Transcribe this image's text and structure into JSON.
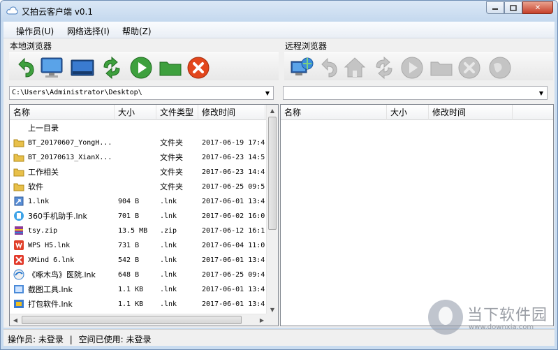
{
  "window": {
    "title": "又拍云客户端 v0.1",
    "controls": {
      "minimize": "▭",
      "maximize": "▢",
      "close": "✕"
    }
  },
  "menu": [
    "操作员(U)",
    "网络选择(I)",
    "帮助(Z)"
  ],
  "local": {
    "label": "本地浏览器",
    "path": "C:\\Users\\Administrator\\Desktop\\",
    "columns": [
      "名称",
      "大小",
      "文件类型",
      "修改时间"
    ],
    "files": [
      {
        "name": "上一目录",
        "size": "",
        "type": "",
        "modified": "",
        "icon": "none"
      },
      {
        "name": "BT_20170607_YongH...",
        "size": "",
        "type": "文件夹",
        "modified": "2017-06-19 17:4",
        "icon": "folder"
      },
      {
        "name": "BT_20170613_XianX...",
        "size": "",
        "type": "文件夹",
        "modified": "2017-06-23 14:5",
        "icon": "folder"
      },
      {
        "name": "工作相关",
        "size": "",
        "type": "文件夹",
        "modified": "2017-06-23 14:4",
        "icon": "folder"
      },
      {
        "name": "软件",
        "size": "",
        "type": "文件夹",
        "modified": "2017-06-25 09:5",
        "icon": "folder"
      },
      {
        "name": "1.lnk",
        "size": "904 B",
        "type": ".lnk",
        "modified": "2017-06-01 13:4",
        "icon": "shortcut"
      },
      {
        "name": "360手机助手.lnk",
        "size": "701 B",
        "type": ".lnk",
        "modified": "2017-06-02 16:0",
        "icon": "app-360"
      },
      {
        "name": "tsy.zip",
        "size": "13.5 MB",
        "type": ".zip",
        "modified": "2017-06-12 16:1",
        "icon": "zip"
      },
      {
        "name": "WPS H5.lnk",
        "size": "731 B",
        "type": ".lnk",
        "modified": "2017-06-04 11:0",
        "icon": "app-wps"
      },
      {
        "name": "XMind 6.lnk",
        "size": "542 B",
        "type": ".lnk",
        "modified": "2017-06-01 13:4",
        "icon": "app-xmind"
      },
      {
        "name": "《啄木鸟》医院.lnk",
        "size": "648 B",
        "type": ".lnk",
        "modified": "2017-06-25 09:4",
        "icon": "app-bird"
      },
      {
        "name": "截图工具.lnk",
        "size": "1.1 KB",
        "type": ".lnk",
        "modified": "2017-06-01 13:4",
        "icon": "app-snip"
      },
      {
        "name": "打包软件.lnk",
        "size": "1.1 KB",
        "type": ".lnk",
        "modified": "2017-06-01 13:4",
        "icon": "app-pack"
      }
    ]
  },
  "remote": {
    "label": "远程浏览器",
    "path": "",
    "columns": [
      "名称",
      "大小",
      "修改时间"
    ]
  },
  "status": {
    "operator_label": "操作员:",
    "operator_value": "未登录",
    "separator": "|",
    "space_label": "空间已使用:",
    "space_value": "未登录"
  },
  "watermark": {
    "name": "当下软件园",
    "url": "www.downxia.com"
  },
  "colors": {
    "title_bg": "#c4d8ee",
    "accent_green": "#3aa53a",
    "close_red": "#d33a22"
  }
}
